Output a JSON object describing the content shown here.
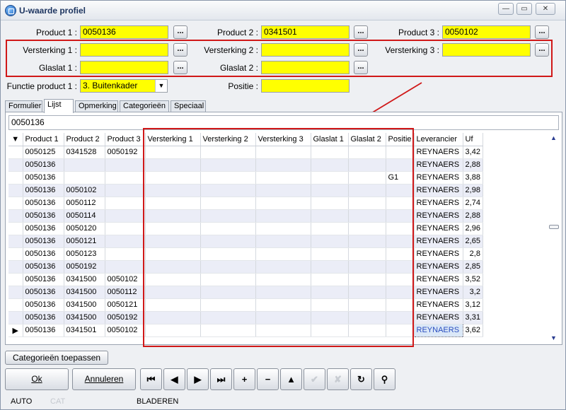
{
  "window": {
    "title": "U-waarde profiel",
    "controls": {
      "minimize": "—",
      "maximize": "▭",
      "close": "✕"
    }
  },
  "form": {
    "product1": {
      "label": "Product 1 :",
      "value": "0050136"
    },
    "product2": {
      "label": "Product 2 :",
      "value": "0341501"
    },
    "product3": {
      "label": "Product 3 :",
      "value": "0050102"
    },
    "versterking1": {
      "label": "Versterking 1 :",
      "value": ""
    },
    "versterking2": {
      "label": "Versterking 2 :",
      "value": ""
    },
    "versterking3": {
      "label": "Versterking 3 :",
      "value": ""
    },
    "glaslat1": {
      "label": "Glaslat 1 :",
      "value": ""
    },
    "glaslat2": {
      "label": "Glaslat 2 :",
      "value": ""
    },
    "functie": {
      "label": "Functie product 1 :",
      "value": "3. Buitenkader"
    },
    "positie": {
      "label": "Positie :",
      "value": ""
    },
    "lookup_label": "..."
  },
  "tabs": [
    "Formulier",
    "Lijst",
    "Opmerking",
    "Categorieën",
    "Speciaal"
  ],
  "active_tab": "Lijst",
  "filter_value": "0050136",
  "grid": {
    "columns": [
      "Product 1",
      "Product 2",
      "Product 3",
      "Versterking 1",
      "Versterking 2",
      "Versterking 3",
      "Glaslat 1",
      "Glaslat 2",
      "Positie",
      "Leverancier",
      "Uf"
    ],
    "rows": [
      [
        "0050125",
        "0341528",
        "0050192",
        "",
        "",
        "",
        "",
        "",
        "",
        "REYNAERS",
        "3,42"
      ],
      [
        "0050136",
        "",
        "",
        "",
        "",
        "",
        "",
        "",
        "",
        "REYNAERS",
        "2,88"
      ],
      [
        "0050136",
        "",
        "",
        "",
        "",
        "",
        "",
        "",
        "G1",
        "REYNAERS",
        "3,88"
      ],
      [
        "0050136",
        "0050102",
        "",
        "",
        "",
        "",
        "",
        "",
        "",
        "REYNAERS",
        "2,98"
      ],
      [
        "0050136",
        "0050112",
        "",
        "",
        "",
        "",
        "",
        "",
        "",
        "REYNAERS",
        "2,74"
      ],
      [
        "0050136",
        "0050114",
        "",
        "",
        "",
        "",
        "",
        "",
        "",
        "REYNAERS",
        "2,88"
      ],
      [
        "0050136",
        "0050120",
        "",
        "",
        "",
        "",
        "",
        "",
        "",
        "REYNAERS",
        "2,96"
      ],
      [
        "0050136",
        "0050121",
        "",
        "",
        "",
        "",
        "",
        "",
        "",
        "REYNAERS",
        "2,65"
      ],
      [
        "0050136",
        "0050123",
        "",
        "",
        "",
        "",
        "",
        "",
        "",
        "REYNAERS",
        "2,8"
      ],
      [
        "0050136",
        "0050192",
        "",
        "",
        "",
        "",
        "",
        "",
        "",
        "REYNAERS",
        "2,85"
      ],
      [
        "0050136",
        "0341500",
        "0050102",
        "",
        "",
        "",
        "",
        "",
        "",
        "REYNAERS",
        "3,52"
      ],
      [
        "0050136",
        "0341500",
        "0050112",
        "",
        "",
        "",
        "",
        "",
        "",
        "REYNAERS",
        "3,2"
      ],
      [
        "0050136",
        "0341500",
        "0050121",
        "",
        "",
        "",
        "",
        "",
        "",
        "REYNAERS",
        "3,12"
      ],
      [
        "0050136",
        "0341500",
        "0050192",
        "",
        "",
        "",
        "",
        "",
        "",
        "REYNAERS",
        "3,31"
      ],
      [
        "0050136",
        "0341501",
        "0050102",
        "",
        "",
        "",
        "",
        "",
        "",
        "REYNAERS",
        "3,62"
      ]
    ],
    "current_row": 14,
    "sort_indicator": "▼",
    "current_indicator": "▶"
  },
  "buttons": {
    "categorieen_toepassen": "Categorieën toepassen",
    "ok": "Ok",
    "annuleren": "Annuleren"
  },
  "navigator": [
    {
      "icon": "first-record-icon",
      "glyph": "⏮",
      "enabled": true
    },
    {
      "icon": "prior-record-icon",
      "glyph": "◀",
      "enabled": true
    },
    {
      "icon": "next-record-icon",
      "glyph": "▶",
      "enabled": true
    },
    {
      "icon": "last-record-icon",
      "glyph": "⏭",
      "enabled": true
    },
    {
      "icon": "insert-record-icon",
      "glyph": "+",
      "enabled": true
    },
    {
      "icon": "delete-record-icon",
      "glyph": "−",
      "enabled": true
    },
    {
      "icon": "edit-record-icon",
      "glyph": "▲",
      "enabled": true
    },
    {
      "icon": "post-record-icon",
      "glyph": "✔",
      "enabled": false
    },
    {
      "icon": "cancel-record-icon",
      "glyph": "✘",
      "enabled": false
    },
    {
      "icon": "refresh-icon",
      "glyph": "↻",
      "enabled": true
    },
    {
      "icon": "binoculars-search-icon",
      "glyph": "⚲",
      "enabled": true
    }
  ],
  "status": {
    "mode": "AUTO",
    "cat": "CAT",
    "state": "BLADEREN"
  },
  "colors": {
    "field_bg": "#ffff00",
    "highlight_box": "#d01818",
    "selected_cell_text": "#2a4dbf"
  }
}
